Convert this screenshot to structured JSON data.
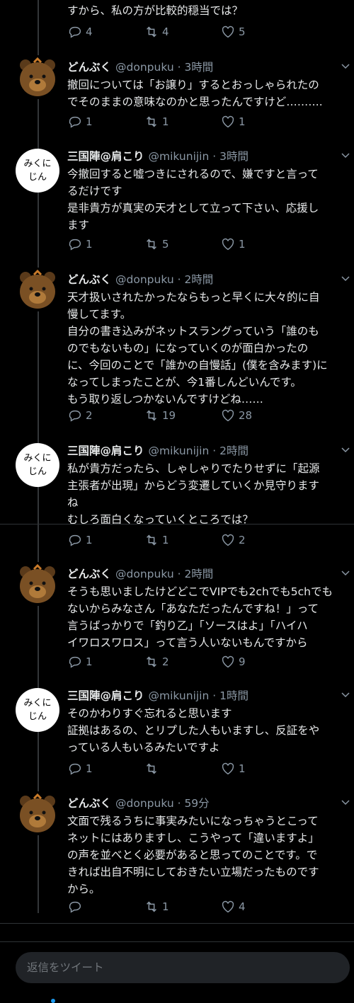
{
  "top_fragment": "すから、私の方が比較的穏当では？",
  "top_actions": {
    "reply": "4",
    "retweet": "4",
    "like": "5"
  },
  "tweets": [
    {
      "name": "どんぶく",
      "handle": "@donpuku",
      "time": "3時間",
      "avatar": "bear",
      "lines": [
        "撤回については「お譲り」するとおっしゃられたの",
        "でそのままの意味なのかと思ったんですけど………."
      ],
      "reply": "1",
      "retweet": "1",
      "like": "1"
    },
    {
      "name": "三国陣@肩こり",
      "handle": "@mikunijin",
      "time": "3時間",
      "avatar": "miku",
      "lines": [
        "今撤回すると嘘つきにされるので、嫌ですと言って",
        "るだけです",
        "是非貴方が真実の天才として立って下さい、応援し",
        "ます"
      ],
      "reply": "1",
      "retweet": "5",
      "like": "1"
    },
    {
      "name": "どんぶく",
      "handle": "@donpuku",
      "time": "2時間",
      "avatar": "bear",
      "lines": [
        "天才扱いされたかったならもっと早くに大々的に自",
        "慢してます。",
        "自分の書き込みがネットスラングっていう「誰のも",
        "のでもないもの」になっていくのが面白かったの",
        "に、今回のことで「誰かの自慢話」(僕を含みます)に",
        "なってしまったことが、今1番しんどいんです。",
        "もう取り返しつかないんですけどね……"
      ],
      "reply": "2",
      "retweet": "19",
      "like": "28"
    },
    {
      "name": "三国陣@肩こり",
      "handle": "@mikunijin",
      "time": "2時間",
      "avatar": "miku",
      "lines": [
        "私が貴方だったら、しゃしゃりでたりせずに「起源",
        "主張者が出現」からどう変遷していくか見守ります",
        "ね",
        "むしろ面白くなっていくところでは？"
      ],
      "reply": "1",
      "retweet": "1",
      "like": "2"
    },
    {
      "name": "どんぶく",
      "handle": "@donpuku",
      "time": "2時間",
      "avatar": "bear",
      "lines": [
        "そうも思いましたけどどこでVIPでも2chでも5chでも",
        "ないからみなさん「あなただったんですね！」って",
        "言うばっかりで「釣り乙」「ソースはよ」「ハイハ",
        "イワロスワロス」って言う人いないもんですから"
      ],
      "reply": "1",
      "retweet": "2",
      "like": "9"
    },
    {
      "name": "三国陣@肩こり",
      "handle": "@mikunijin",
      "time": "1時間",
      "avatar": "miku",
      "lines": [
        "そのかわりすぐ忘れると思います",
        "証拠はあるの、とリプした人もいますし、反証をや",
        "っている人もいるみたいですよ"
      ],
      "reply": "1",
      "retweet": "",
      "like": "1"
    },
    {
      "name": "どんぶく",
      "handle": "@donpuku",
      "time": "59分",
      "avatar": "bear",
      "lines": [
        "文面で残るうちに事実みたいになっちゃうとこって",
        "ネットにはありますし、こうやって「違いますよ」",
        "の声を並べとく必要があると思ってのことです。で",
        "きれば出自不明にしておきたい立場だったものです",
        "から。"
      ],
      "reply": "",
      "retweet": "1",
      "like": "4"
    }
  ],
  "miku_avatar_text": [
    "みくに",
    "じん"
  ],
  "reply_placeholder": "返信をツイート",
  "colors": {
    "background": "#000000",
    "text": "#e7e9ea",
    "muted": "#8b98a5",
    "accent": "#1d9bf0"
  }
}
